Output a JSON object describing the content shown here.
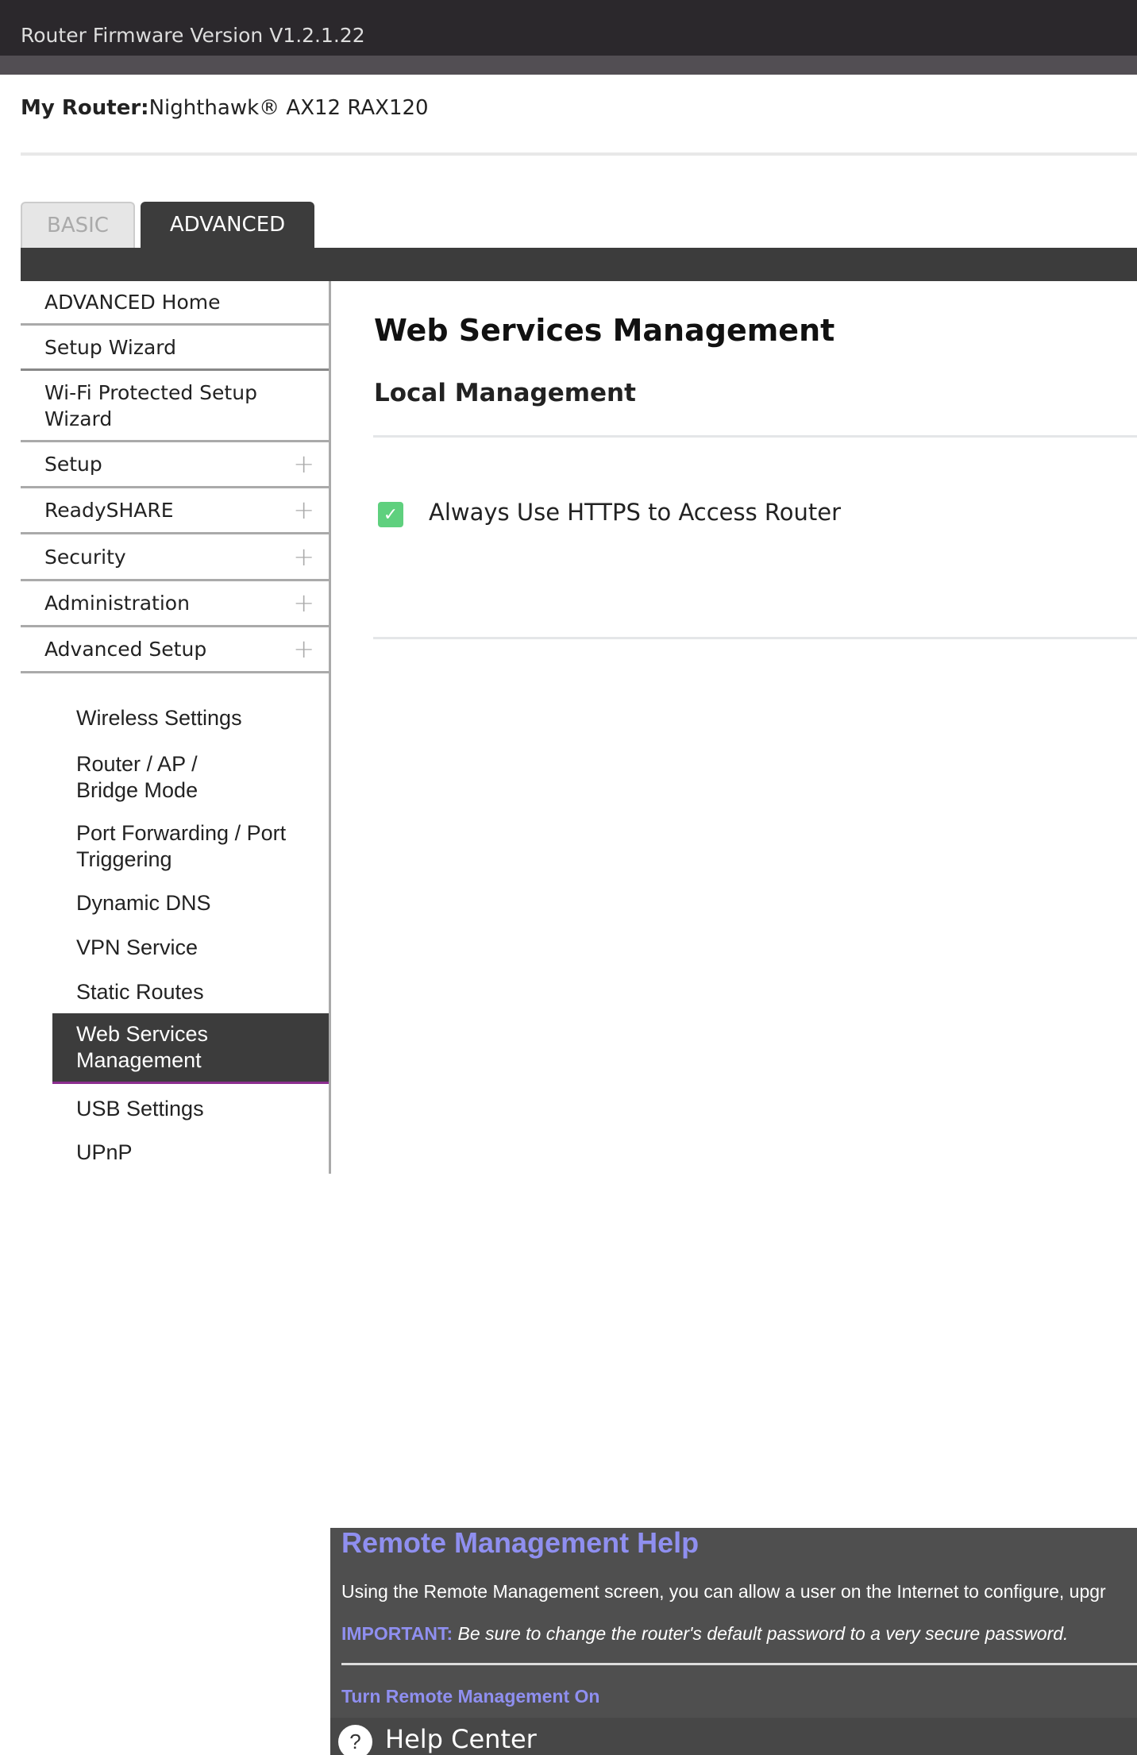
{
  "header": {
    "firmware": "Router Firmware Version V1.2.1.22",
    "my_router_label": "My Router:",
    "my_router_value": "Nighthawk® AX12 RAX120"
  },
  "tabs": [
    {
      "label": "BASIC",
      "active": false
    },
    {
      "label": "ADVANCED",
      "active": true
    }
  ],
  "sidebar": {
    "items": [
      {
        "label": "ADVANCED Home"
      },
      {
        "label": "Setup Wizard"
      },
      {
        "label": "Wi-Fi Protected Setup Wizard"
      },
      {
        "label": "Setup",
        "icon": "plus-icon"
      },
      {
        "label": "ReadySHARE",
        "icon": "plus-icon"
      },
      {
        "label": "Security",
        "icon": "plus-icon"
      },
      {
        "label": "Administration",
        "icon": "plus-icon"
      },
      {
        "label": "Advanced Setup",
        "icon": "plus-icon"
      }
    ],
    "sub_items": [
      {
        "label": "Wireless Settings"
      },
      {
        "label": "Router / AP / Bridge Mode"
      },
      {
        "label": "Port Forwarding / Port Triggering"
      },
      {
        "label": "Dynamic DNS"
      },
      {
        "label": "VPN Service"
      },
      {
        "label": "Static Routes"
      },
      {
        "label": "Web Services Management",
        "selected": true
      },
      {
        "label": "USB Settings"
      },
      {
        "label": "UPnP"
      }
    ]
  },
  "main": {
    "title": "Web Services Management",
    "section": "Local Management",
    "https_checkbox": {
      "label": "Always Use HTTPS to Access Router",
      "checked": true
    }
  },
  "help": {
    "title": "Remote Management Help",
    "body": "Using the Remote Management screen, you can allow a user on the Internet to configure, upgr",
    "important_label": "IMPORTANT:",
    "important_text": " Be sure to change the router's default password to a very secure password.",
    "link": "Turn Remote Management On",
    "help_center": "Help Center",
    "help_icon": "?"
  },
  "colors": {
    "accent": "#8f8ff0",
    "selected_underline": "#8b2e8f",
    "checkbox": "#5fd07e",
    "dark": "#3c3c3c"
  }
}
